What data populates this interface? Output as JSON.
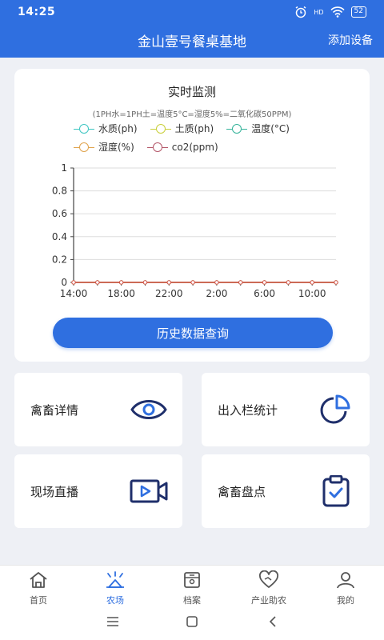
{
  "status_bar": {
    "time": "14:25",
    "network": "HD",
    "battery": "52"
  },
  "header": {
    "title": "金山壹号餐桌基地",
    "action_label": "添加设备"
  },
  "monitor": {
    "title": "实时监测",
    "note": "(1PH水=1PH土=温度5°C=湿度5%=二氧化碳50PPM)",
    "legend": [
      {
        "label": "水质(ph)",
        "color": "#3ec6c2"
      },
      {
        "label": "土质(ph)",
        "color": "#c9cf3b"
      },
      {
        "label": "温度(°C)",
        "color": "#35b39a"
      },
      {
        "label": "湿度(%)",
        "color": "#e0a44e"
      },
      {
        "label": "co2(ppm)",
        "color": "#b4586a"
      }
    ],
    "history_button": "历史数据查询"
  },
  "chart_data": {
    "type": "line",
    "x": [
      "14:00",
      "16:00",
      "18:00",
      "20:00",
      "22:00",
      "0:00",
      "2:00",
      "4:00",
      "6:00",
      "8:00",
      "10:00",
      "12:00"
    ],
    "x_tick_labels": [
      "14:00",
      "18:00",
      "22:00",
      "2:00",
      "6:00",
      "10:00"
    ],
    "y_ticks": [
      "0",
      "0.2",
      "0.4",
      "0.6",
      "0.8",
      "1"
    ],
    "ylim": [
      0,
      1
    ],
    "grid": true,
    "series": [
      {
        "name": "水质(ph)",
        "color": "#3ec6c2",
        "values": [
          0,
          0,
          0,
          0,
          0,
          0,
          0,
          0,
          0,
          0,
          0,
          0
        ]
      },
      {
        "name": "土质(ph)",
        "color": "#c9cf3b",
        "values": [
          0,
          0,
          0,
          0,
          0,
          0,
          0,
          0,
          0,
          0,
          0,
          0
        ]
      },
      {
        "name": "温度(°C)",
        "color": "#35b39a",
        "values": [
          0,
          0,
          0,
          0,
          0,
          0,
          0,
          0,
          0,
          0,
          0,
          0
        ]
      },
      {
        "name": "湿度(%)",
        "color": "#e0a44e",
        "values": [
          0,
          0,
          0,
          0,
          0,
          0,
          0,
          0,
          0,
          0,
          0,
          0
        ]
      },
      {
        "name": "co2(ppm)",
        "color": "#d9534f",
        "values": [
          0,
          0,
          0,
          0,
          0,
          0,
          0,
          0,
          0,
          0,
          0,
          0
        ]
      }
    ]
  },
  "features": [
    {
      "label": "禽畜详情",
      "icon": "eye-icon"
    },
    {
      "label": "出入栏统计",
      "icon": "pie-chart-icon"
    },
    {
      "label": "现场直播",
      "icon": "video-icon"
    },
    {
      "label": "禽畜盘点",
      "icon": "clipboard-check-icon"
    }
  ],
  "nav": [
    {
      "label": "首页",
      "icon": "home-icon",
      "active": false
    },
    {
      "label": "农场",
      "icon": "farm-icon",
      "active": true
    },
    {
      "label": "档案",
      "icon": "archive-icon",
      "active": false
    },
    {
      "label": "产业助农",
      "icon": "heart-icon",
      "active": false
    },
    {
      "label": "我的",
      "icon": "user-icon",
      "active": false
    }
  ],
  "colors": {
    "primary": "#2f6fe0",
    "background": "#eef0f5",
    "icon_dark": "#1f2f6b"
  }
}
